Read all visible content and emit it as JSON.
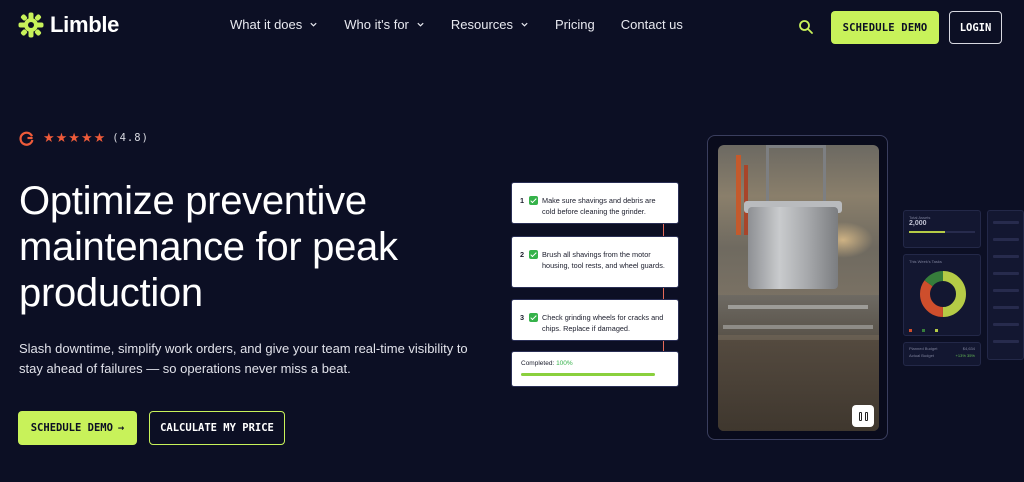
{
  "brand": {
    "name": "Limble",
    "accent": "#c8f25a",
    "background": "#0c0f24"
  },
  "nav": {
    "links": [
      {
        "label": "What it does",
        "has_dropdown": true
      },
      {
        "label": "Who it's for",
        "has_dropdown": true
      },
      {
        "label": "Resources",
        "has_dropdown": true
      },
      {
        "label": "Pricing",
        "has_dropdown": false
      },
      {
        "label": "Contact us",
        "has_dropdown": false
      }
    ],
    "search_icon": "search-icon",
    "schedule_demo": "SCHEDULE DEMO",
    "login": "LOGIN"
  },
  "hero": {
    "rating": {
      "source_icon": "g2-icon",
      "stars": "★★★★★",
      "value": "(4.8)"
    },
    "title": "Optimize preventive maintenance for peak production",
    "subtitle": "Slash downtime, simplify work orders, and give your team real-time visibility to stay ahead of failures — so operations never miss a beat.",
    "cta_primary": "SCHEDULE DEMO",
    "cta_primary_icon": "→",
    "cta_secondary": "CALCULATE MY PRICE"
  },
  "checklist": {
    "tasks": [
      {
        "num": "1",
        "text": "Make sure shavings and debris are cold before cleaning the grinder."
      },
      {
        "num": "2",
        "text": "Brush all shavings from the motor housing, tool rests, and wheel guards."
      },
      {
        "num": "3",
        "text": "Check grinding wheels for cracks and chips. Replace if damaged."
      }
    ],
    "progress": {
      "label": "Completed:",
      "value": "100%",
      "fraction": 1.0
    }
  },
  "media": {
    "pause_icon": "pause-icon"
  },
  "dashboard": {
    "stat_label": "Total Assets",
    "stat_value": "2,000",
    "chart_title": "This Week's Tasks",
    "donut_colors": [
      "#c8e04a",
      "#e4552d",
      "#3b8a3e"
    ],
    "donut_values": [
      0.5,
      0.35,
      0.15
    ],
    "rows": [
      {
        "label": "Planned Budget",
        "value": "$4,634"
      },
      {
        "label": "Actual Budget",
        "value": "+13% 35%"
      }
    ]
  }
}
